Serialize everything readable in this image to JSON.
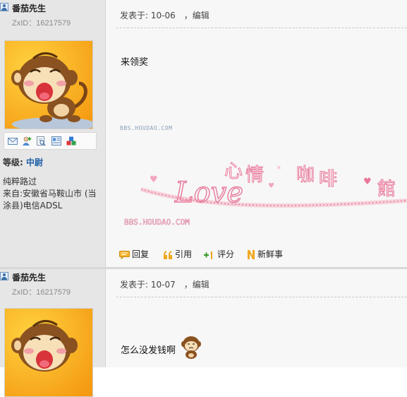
{
  "posts": [
    {
      "author": "番茄先生",
      "zxid": "ZxID：16217579",
      "grade_label": "等级:",
      "grade_value": "中尉",
      "signature": "纯粹路过",
      "location": "来自:安徽省马鞍山市 (当涂县)电信ADSL",
      "posted_label": "发表于:",
      "posted_date": "10-06",
      "edit_link": "，编辑",
      "content": "来领奖",
      "footer": {
        "reply": "回复",
        "quote": "引用",
        "rate": "评分",
        "news": "新鲜事"
      }
    },
    {
      "author": "番茄先生",
      "zxid": "ZxID：16217579",
      "posted_label": "发表于:",
      "posted_date": "10-07",
      "edit_link": "，编辑",
      "content": "怎么没发钱啊"
    }
  ],
  "banner": {
    "watermark_top": "BBS.HOUDAO.COM",
    "script_word": "Love",
    "chars": [
      "心",
      "情",
      "咖",
      "啡",
      "館"
    ],
    "watermark_bottom": "BBS.HOUDAO.COM"
  },
  "colors": {
    "rank": "#1d5fa6",
    "sidebar_bg": "#e6e6e6",
    "post_bg": "#f7f7f7",
    "banner_pink": "#e8799a"
  },
  "icons": [
    "user-icon",
    "message-icon",
    "add-friend-icon",
    "profile-icon",
    "userinfo-icon",
    "blocks-icon",
    "reply-icon",
    "quote-icon",
    "rate-icon",
    "news-icon",
    "monkey-emoticon"
  ]
}
